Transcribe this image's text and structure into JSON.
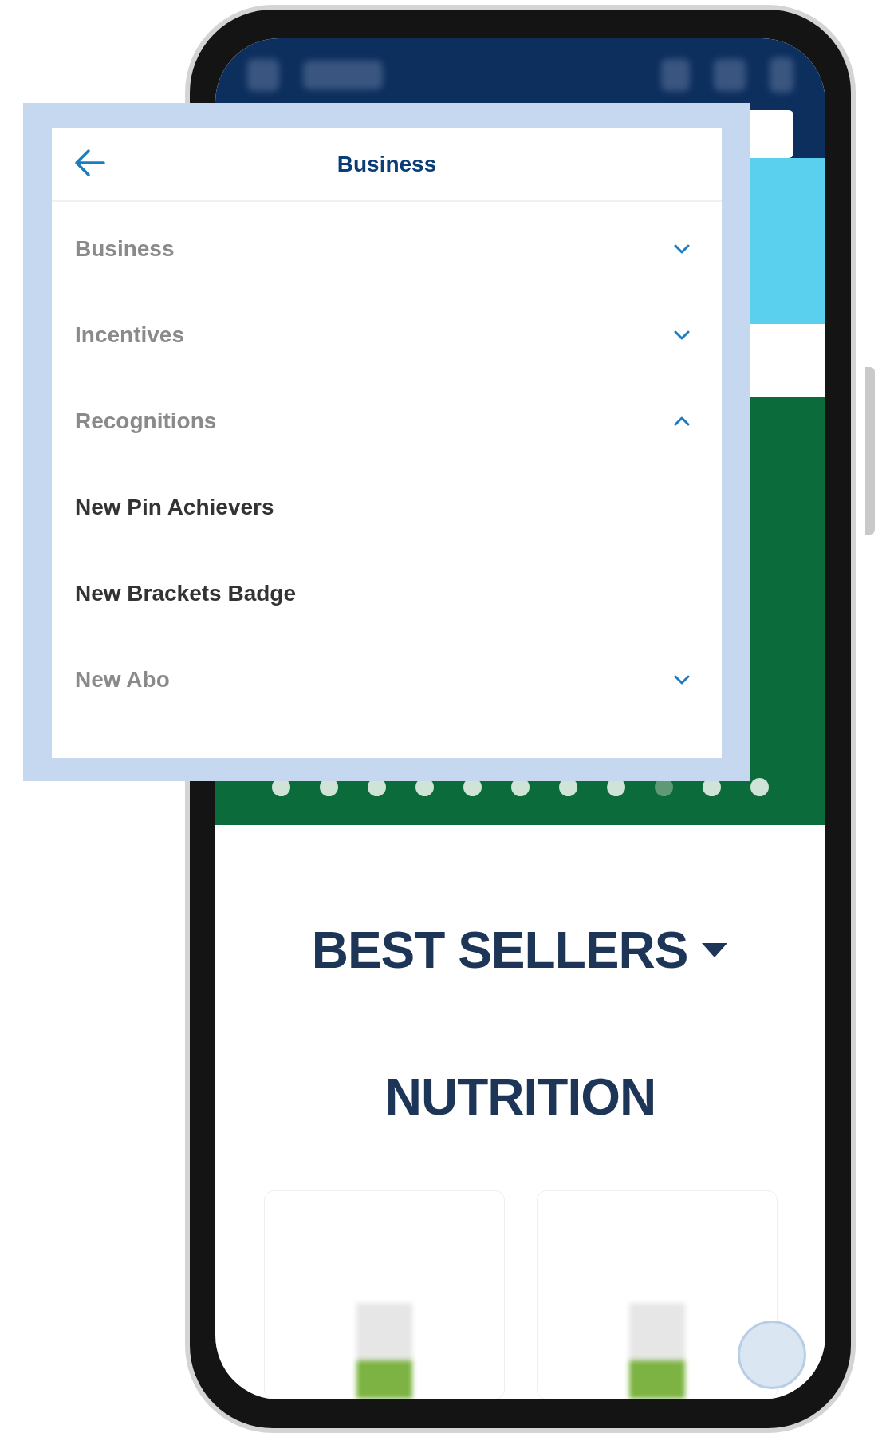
{
  "menu": {
    "title": "Business",
    "items": [
      {
        "label": "Business",
        "kind": "group",
        "expanded": false
      },
      {
        "label": "Incentives",
        "kind": "group",
        "expanded": false
      },
      {
        "label": "Recognitions",
        "kind": "group",
        "expanded": true,
        "children": [
          {
            "label": "New Pin Achievers",
            "kind": "link"
          },
          {
            "label": "New Brackets Badge",
            "kind": "link"
          }
        ]
      },
      {
        "label": "New Abo",
        "kind": "group",
        "expanded": false
      }
    ]
  },
  "carousel": {
    "dots": [
      {
        "selected": false
      },
      {
        "selected": false
      },
      {
        "selected": false
      },
      {
        "selected": false
      },
      {
        "selected": false
      },
      {
        "selected": false
      },
      {
        "selected": false
      },
      {
        "selected": false
      },
      {
        "selected": true
      },
      {
        "selected": false
      },
      {
        "selected": false
      }
    ]
  },
  "sections": [
    {
      "title": "BEST SELLERS",
      "kind": "dropdown"
    },
    {
      "title": "NUTRITION",
      "kind": "heading"
    }
  ]
}
